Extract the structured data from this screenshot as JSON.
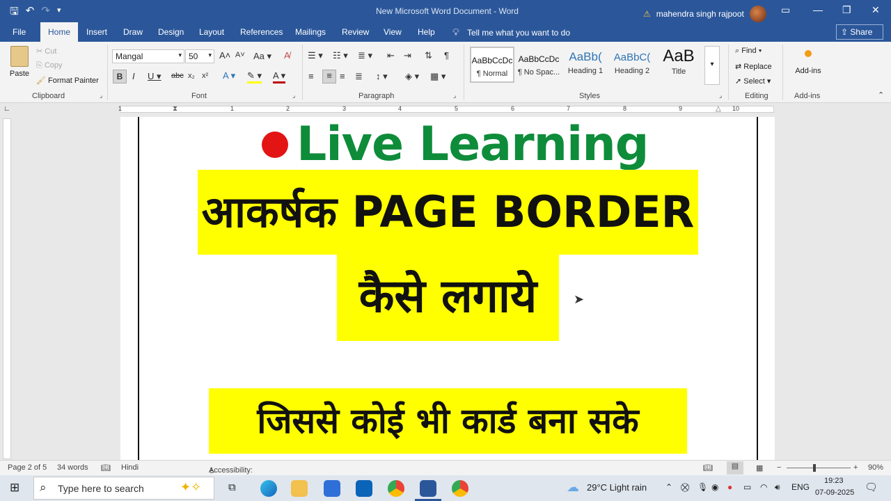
{
  "titlebar": {
    "title": "New Microsoft Word Document  -  Word",
    "user": "mahendra singh rajpoot"
  },
  "menu": {
    "tabs": [
      "File",
      "Home",
      "Insert",
      "Draw",
      "Design",
      "Layout",
      "References",
      "Mailings",
      "Review",
      "View",
      "Help"
    ],
    "active_tab": "Home",
    "tell_me": "Tell me what you want to do",
    "share": "Share"
  },
  "ribbon": {
    "clipboard": {
      "paste": "Paste",
      "cut": "Cut",
      "copy": "Copy",
      "format_painter": "Format Painter",
      "label": "Clipboard"
    },
    "font": {
      "name": "Mangal",
      "size": "50",
      "label": "Font",
      "change_case": "Aa"
    },
    "paragraph": {
      "label": "Paragraph"
    },
    "styles": {
      "label": "Styles",
      "items": [
        {
          "sample": "AaBbCcDc",
          "name": "¶ Normal"
        },
        {
          "sample": "AaBbCcDc",
          "name": "¶ No Spac..."
        },
        {
          "sample": "AaBb(",
          "name": "Heading 1"
        },
        {
          "sample": "AaBbC(",
          "name": "Heading 2"
        },
        {
          "sample": "AaB",
          "name": "Title"
        }
      ]
    },
    "editing": {
      "find": "Find",
      "replace": "Replace",
      "select": "Select",
      "label": "Editing"
    },
    "addins": {
      "button": "Add-ins",
      "label": "Add-ins"
    }
  },
  "ruler": {
    "numbers": [
      "1",
      "1",
      "2",
      "3",
      "4",
      "5",
      "6",
      "7",
      "8",
      "9",
      "10"
    ]
  },
  "document": {
    "line1": "Live Learning",
    "line2": "आकर्षक  PAGE  BORDER",
    "line3": "कैसे  लगाये",
    "line4": "जिससे  कोई  भी  कार्ड  बना  सके"
  },
  "status": {
    "page": "Page 2 of 5",
    "words": "34 words",
    "language": "Hindi",
    "accessibility": "Accessibility: Investigate",
    "zoom": "90%"
  },
  "taskbar": {
    "search_placeholder": "Type here to search",
    "weather": "29°C  Light rain",
    "lang": "ENG",
    "time": "19:23",
    "date": "07-09-2025"
  },
  "colors": {
    "word_blue": "#2b579a",
    "live_green": "#0e8c3a",
    "highlight": "#ffff00",
    "dot_red": "#e31414"
  }
}
